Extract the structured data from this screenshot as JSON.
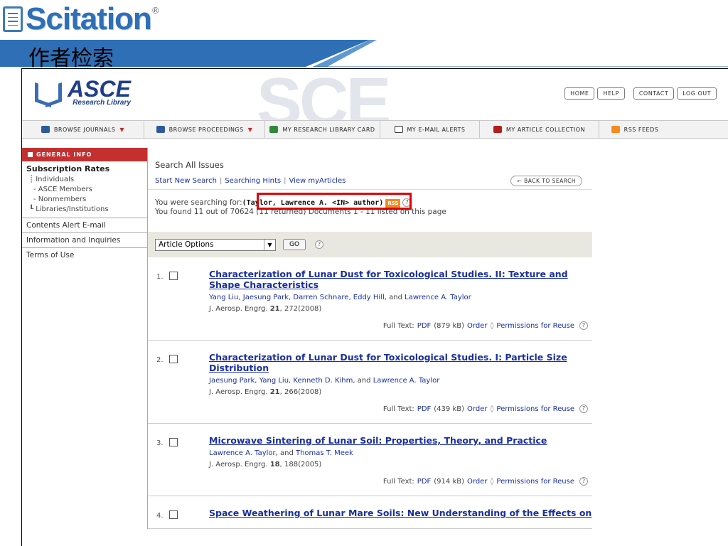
{
  "slide_title": "作者检索",
  "brand": {
    "name": "Scitation",
    "registered": "®"
  },
  "asce": {
    "name": "ASCE",
    "subtitle": "Research Library",
    "watermark": "SCE"
  },
  "header_buttons": [
    "HOME",
    "HELP",
    "CONTACT",
    "LOG OUT"
  ],
  "nav": [
    {
      "label": "BROWSE JOURNALS",
      "caret": true,
      "icon_color": "#2d5a9b",
      "icon": "journal-icon"
    },
    {
      "label": "BROWSE PROCEEDINGS",
      "caret": true,
      "icon_color": "#2d5a9b",
      "icon": "proceedings-icon"
    },
    {
      "label": "MY RESEARCH LIBRARY CARD",
      "caret": false,
      "icon_color": "#2f8a3a",
      "icon": "library-card-icon"
    },
    {
      "label": "MY E-MAIL ALERTS",
      "caret": false,
      "icon_color": "#ffffff",
      "icon": "email-icon"
    },
    {
      "label": "MY ARTICLE COLLECTION",
      "caret": false,
      "icon_color": "#b32020",
      "icon": "collection-icon"
    },
    {
      "label": "RSS FEEDS",
      "caret": false,
      "icon_color": "#f58b1e",
      "icon": "rss-icon"
    }
  ],
  "sidebar": {
    "header": "GENERAL INFO",
    "subscription": {
      "title": "Subscription Rates",
      "items": [
        "Individuals",
        "- ASCE Members",
        "- Nonmembers",
        "Libraries/Institutions"
      ]
    },
    "links": [
      "Contents Alert E-mail",
      "Information and Inquiries",
      "Terms of Use"
    ]
  },
  "main": {
    "title": "Search All Issues",
    "links": [
      "Start New Search",
      "Searching Hints",
      "View myArticles"
    ],
    "back": "← BACK TO SEARCH",
    "searching_prefix": "You were searching for:",
    "query": "(Taylor, Lawrence A. <IN> author)",
    "rss": "RSS",
    "found": "You found 11 out of 70624 (11 returned) Documents 1 - 11 listed on this page",
    "select_value": "Article Options",
    "go": "GO",
    "help": "?"
  },
  "results": [
    {
      "num": "1.",
      "title": "Characterization of Lunar Dust for Toxicological Studies. II: Texture and Shape Characteristics",
      "authors": [
        "Yang Liu",
        "Jaesung Park",
        "Darren Schnare",
        "Eddy Hill",
        "Lawrence A. Taylor"
      ],
      "journal": "J. Aerosp. Engrg.",
      "volume": "21",
      "pages": "272(2008)",
      "size": "(879 kB)"
    },
    {
      "num": "2.",
      "title": "Characterization of Lunar Dust for Toxicological Studies. I: Particle Size Distribution",
      "authors": [
        "Jaesung Park",
        "Yang Liu",
        "Kenneth D. Kihm",
        "Lawrence A. Taylor"
      ],
      "journal": "J. Aerosp. Engrg.",
      "volume": "21",
      "pages": "266(2008)",
      "size": "(439 kB)"
    },
    {
      "num": "3.",
      "title": "Microwave Sintering of Lunar Soil: Properties, Theory, and Practice",
      "authors": [
        "Lawrence A. Taylor",
        "Thomas T. Meek"
      ],
      "journal": "J. Aerosp. Engrg.",
      "volume": "18",
      "pages": "188(2005)",
      "size": "(914 kB)"
    },
    {
      "num": "4.",
      "title": "Space Weathering of Lunar Mare Soils: New Understanding of the Effects on",
      "authors": [],
      "journal": "",
      "volume": "",
      "pages": "",
      "size": ""
    }
  ],
  "result_labels": {
    "full_text": "Full Text:",
    "pdf": "PDF",
    "order": "Order",
    "permissions": "Permissions for Reuse"
  }
}
